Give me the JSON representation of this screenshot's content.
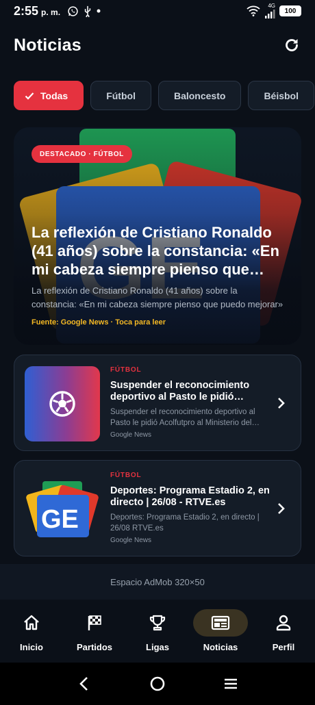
{
  "status_bar": {
    "time": "2:55",
    "ampm": "p. m.",
    "network": "4G",
    "battery": "100"
  },
  "header": {
    "title": "Noticias"
  },
  "chips": [
    {
      "label": "Todas",
      "active": true
    },
    {
      "label": "Fútbol",
      "active": false
    },
    {
      "label": "Baloncesto",
      "active": false
    },
    {
      "label": "Béisbol",
      "active": false
    }
  ],
  "featured": {
    "badge": "DESTACADO · FÚTBOL",
    "title": "La reflexión de Cristiano Ronaldo (41 años) sobre la constancia: «En mi cabeza siempre pienso que puedo mejorar»",
    "description": "La reflexión de Cristiano Ronaldo (41 años) sobre la constancia: «En mi cabeza siempre pienso que puedo mejorar»",
    "source": "Fuente: Google News · Toca para leer",
    "logo_text": "GE"
  },
  "news": [
    {
      "category": "FÚTBOL",
      "title": "Suspender el reconocimiento deportivo al Pasto le pidió Acolfutpro al Ministerio del Deporte",
      "description": "Suspender el reconocimiento deportivo al Pasto le pidió Acolfutpro al Ministerio del Deporte",
      "source": "Google News",
      "thumb": "soccer-ball-icon"
    },
    {
      "category": "FÚTBOL",
      "title": "Deportes: Programa Estadio 2, en directo | 26/08 - RTVE.es",
      "description": "Deportes: Programa Estadio 2, en directo | 26/08 RTVE.es",
      "source": "Google News",
      "thumb": "google-news-icon",
      "logo_text": "GE"
    }
  ],
  "ad": {
    "label": "Espacio AdMob 320×50"
  },
  "bottom_nav": [
    {
      "label": "Inicio",
      "icon": "home-icon"
    },
    {
      "label": "Partidos",
      "icon": "checkered-flag-icon"
    },
    {
      "label": "Ligas",
      "icon": "trophy-icon"
    },
    {
      "label": "Noticias",
      "icon": "newspaper-icon",
      "active": true
    },
    {
      "label": "Perfil",
      "icon": "person-icon"
    }
  ],
  "colors": {
    "accent": "#e5323f",
    "background": "#0b1018",
    "card": "#141c27",
    "source_yellow": "#f3b824"
  }
}
